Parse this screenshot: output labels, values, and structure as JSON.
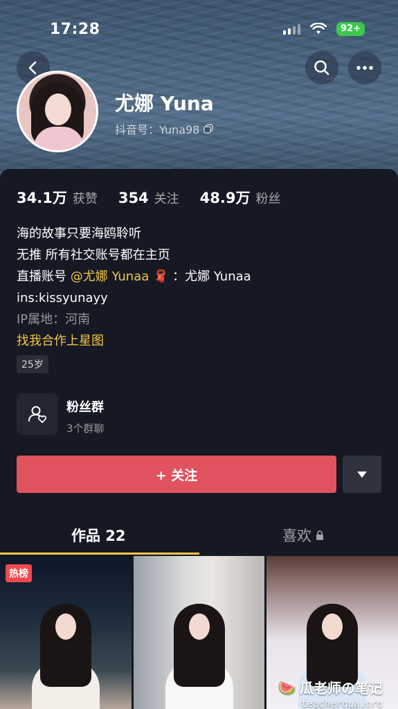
{
  "status_bar": {
    "time": "17:28",
    "battery": "92+"
  },
  "profile": {
    "name": "尤娜 Yuna",
    "douyin_id": "抖音号：Yuna98"
  },
  "stats": [
    {
      "value": "34.1万",
      "label": "获赞"
    },
    {
      "value": "354",
      "label": "关注"
    },
    {
      "value": "48.9万",
      "label": "粉丝"
    }
  ],
  "bio": {
    "line1": "海的故事只要海鸥聆听",
    "line2": "无推  所有社交账号都在主页",
    "line3_prefix": "直播账号",
    "line3_mention": "@尤娜 Yunaa",
    "line3_suffix": "：尤娜 Yunaa",
    "line4": "ins:kissyunayy",
    "ip_location": "IP属地：河南",
    "business_link": "找我合作上星图",
    "age_tag": "25岁"
  },
  "fan_group": {
    "title": "粉丝群",
    "subtitle": "3个群聊"
  },
  "actions": {
    "follow_label": "+ 关注"
  },
  "tabs": [
    {
      "label": "作品 22"
    },
    {
      "label": "喜欢"
    }
  ],
  "videos": [
    {
      "badge": "热榜"
    },
    {},
    {}
  ],
  "watermark": {
    "title": "瓜老师の笔记",
    "url": "teachergua.org"
  },
  "colors": {
    "accent_red": "#e0525d",
    "accent_gold": "#f2c84b",
    "background": "#161823"
  }
}
